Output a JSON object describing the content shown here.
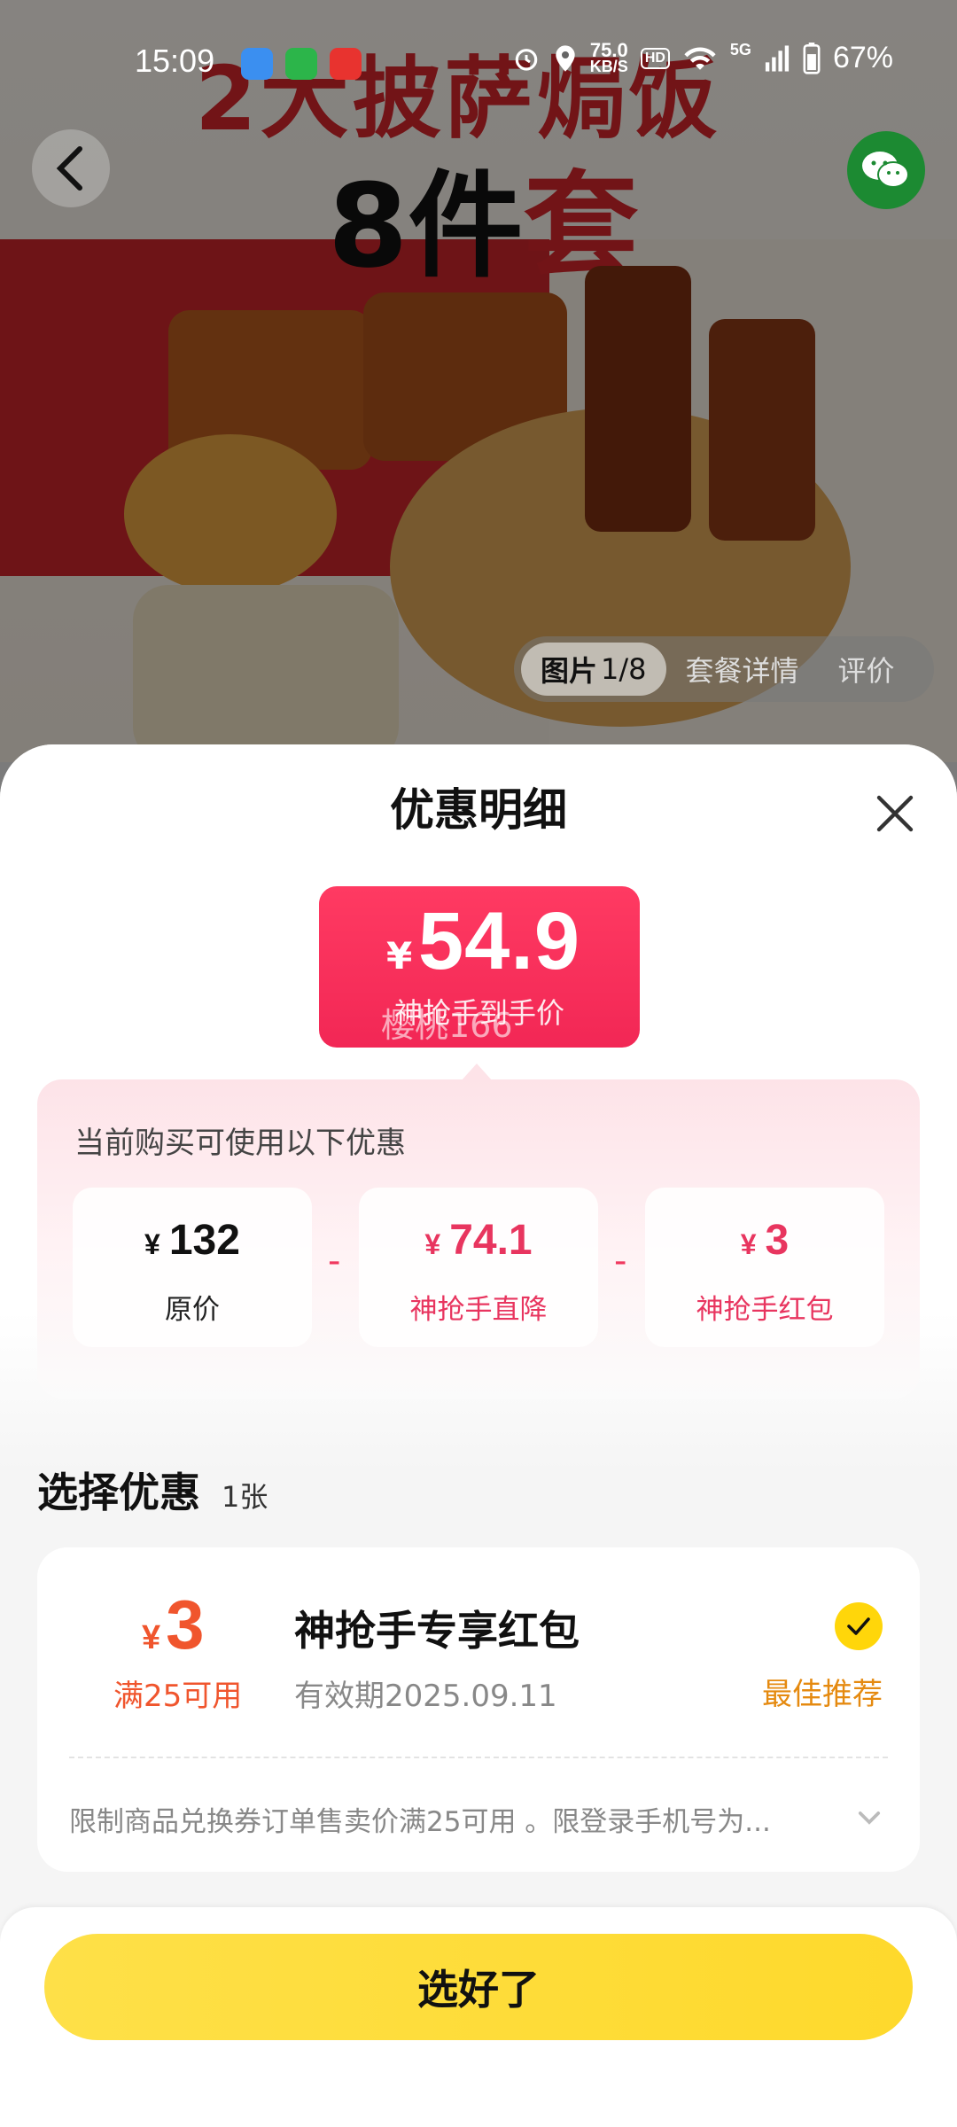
{
  "status_bar": {
    "time": "15:09",
    "network_speed": "75.0",
    "network_unit": "KB/S",
    "hd": "HD",
    "signal": "5G",
    "battery": "67%"
  },
  "hero": {
    "title_line1": "2大披萨焗饭",
    "title_line2_prefix": "8件",
    "title_line2_suffix": "套",
    "tabs": {
      "photo_label": "图片",
      "photo_index": "1/8",
      "details_label": "套餐详情",
      "reviews_label": "评价"
    }
  },
  "sheet": {
    "title": "优惠明细",
    "final_price": {
      "currency": "¥",
      "amount": "54.9",
      "label": "神抢手到手价",
      "watermark": "樱桃166"
    },
    "discount_hint": "当前购买可使用以下优惠",
    "breakdown": [
      {
        "currency": "¥",
        "value": "132",
        "label": "原价"
      },
      {
        "currency": "¥",
        "value": "74.1",
        "label": "神抢手直降"
      },
      {
        "currency": "¥",
        "value": "3",
        "label": "神抢手红包"
      }
    ],
    "operators": [
      "-",
      "-"
    ],
    "select": {
      "title": "选择优惠",
      "count": "1张"
    },
    "coupon": {
      "currency": "¥",
      "amount": "3",
      "condition": "满25可用",
      "name": "神抢手专享红包",
      "validity": "有效期2025.09.11",
      "badge": "最佳推荐",
      "description": "限制商品兑换券订单售卖价满25可用 。限登录手机号为..."
    },
    "confirm_label": "选好了"
  },
  "colors": {
    "price_badge": "#f22755",
    "discount_accent": "#e8355f",
    "coupon_accent": "#f0552d",
    "best_badge": "#e58a10",
    "confirm_button": "#fed92c"
  }
}
